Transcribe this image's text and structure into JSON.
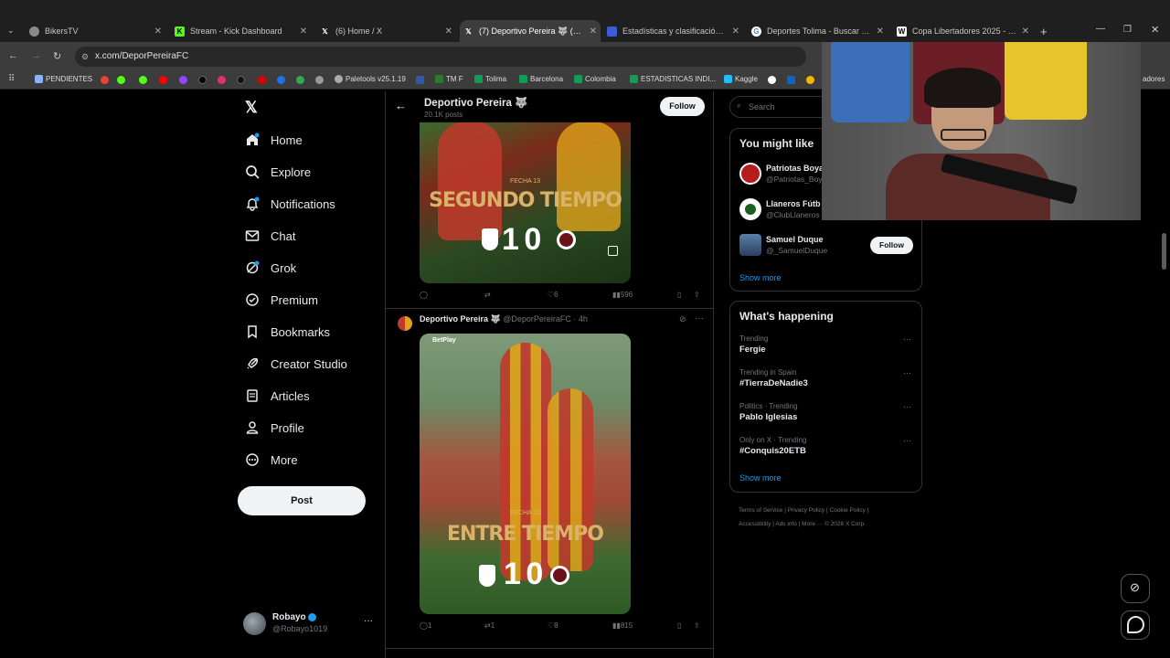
{
  "browser": {
    "tabs": [
      {
        "label": "BikersTV",
        "fav": "#8a8a8a"
      },
      {
        "label": "Stream - Kick Dashboard",
        "fav": "#53fc18"
      },
      {
        "label": "(6) Home / X",
        "fav": "#000"
      },
      {
        "label": "(7) Deportivo Pereira 🐺 (@De",
        "fav": "#000",
        "active": true
      },
      {
        "label": "Estadísticas y clasificación de B",
        "fav": "#3b5bdb"
      },
      {
        "label": "Deportes Tolima - Buscar con G",
        "fav": "#4285f4"
      },
      {
        "label": "Copa Libertadores 2025 - Wikip",
        "fav": "#fff"
      }
    ],
    "url": "x.com/DeporPereiraFC",
    "bookmarks": [
      "PENDIENTES",
      "Paletools v25.1.19",
      "TM F",
      "Tolima",
      "Barcelona",
      "Colombia",
      "ESTADISTICAS INDI...",
      "Kaggle",
      "adores"
    ]
  },
  "sidebar": {
    "items": [
      {
        "label": "Home"
      },
      {
        "label": "Explore"
      },
      {
        "label": "Notifications"
      },
      {
        "label": "Chat"
      },
      {
        "label": "Grok"
      },
      {
        "label": "Premium"
      },
      {
        "label": "Bookmarks"
      },
      {
        "label": "Creator Studio"
      },
      {
        "label": "Articles"
      },
      {
        "label": "Profile"
      },
      {
        "label": "More"
      }
    ],
    "post_label": "Post",
    "account": {
      "name": "Robayo",
      "handle": "@Robayo1019"
    }
  },
  "header": {
    "name": "Deportivo Pereira 🐺",
    "posts": "20.1K posts",
    "follow_label": "Follow"
  },
  "posts": [
    {
      "media_label": "FECHA 13",
      "media_title": "SEGUNDO TIEMPO",
      "score": "1 0",
      "stats": {
        "replies": "",
        "reposts": "",
        "likes": "6",
        "views": "596"
      }
    },
    {
      "author": "Deportivo Pereira 🐺",
      "handle_time": "@DeporPereiraFC · 4h",
      "media_label": "FECHA 13",
      "media_title": "ENTRE TIEMPO",
      "score": "1 0",
      "media_brand": "BetPlay",
      "stats": {
        "replies": "1",
        "reposts": "1",
        "likes": "8",
        "views": "815"
      }
    }
  ],
  "right": {
    "search_placeholder": "Search",
    "you_might_like": {
      "title": "You might like",
      "accounts": [
        {
          "name": "Patriotas Boya",
          "handle": "@Patriotas_Boy"
        },
        {
          "name": "Llaneros Fútb",
          "handle": "@ClubLlaneros"
        },
        {
          "name": "Samuel Duque",
          "handle": "@_SamuelDuque",
          "follow": "Follow"
        }
      ],
      "show_more": "Show more"
    },
    "whats_happening": {
      "title": "What's happening",
      "trends": [
        {
          "context": "Trending",
          "topic": "Fergie"
        },
        {
          "context": "Trending in Spain",
          "topic": "#TierraDeNadie3"
        },
        {
          "context": "Politics · Trending",
          "topic": "Pablo Iglesias"
        },
        {
          "context": "Only on X · Trending",
          "topic": "#Conquis20ETB"
        }
      ],
      "show_more": "Show more"
    },
    "footer": {
      "line1": [
        "Terms of Service",
        "Privacy Policy",
        "Cookie Policy"
      ],
      "line2": [
        "Accessibility",
        "Ads info",
        "More ···",
        "© 2026 X Corp."
      ]
    }
  }
}
